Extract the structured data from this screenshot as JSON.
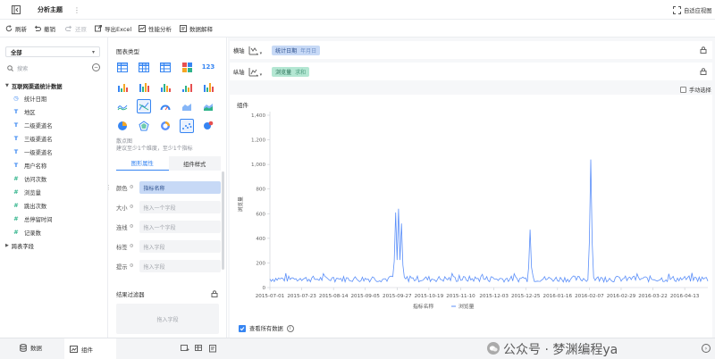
{
  "titlebar": {
    "title": "分析主题",
    "more_icon": "more-vertical-icon",
    "right_label": "自适应视图"
  },
  "toolbar": {
    "items": [
      {
        "label": "刷新",
        "icon": "refresh-icon",
        "enabled": true
      },
      {
        "label": "撤销",
        "icon": "undo-icon",
        "enabled": true
      },
      {
        "label": "还原",
        "icon": "redo-icon",
        "enabled": false
      },
      {
        "label": "导出Excel",
        "icon": "export-icon",
        "enabled": true
      },
      {
        "label": "性能分析",
        "icon": "performance-icon",
        "enabled": true
      },
      {
        "label": "数据解释",
        "icon": "explain-icon",
        "enabled": true
      }
    ]
  },
  "left_panel": {
    "scope_select": "全部",
    "search_placeholder": "搜索",
    "table_name": "互联网渠道统计数据",
    "fields": [
      {
        "type": "date",
        "label": "统计日期"
      },
      {
        "type": "text",
        "label": "地区"
      },
      {
        "type": "text",
        "label": "二级渠道名"
      },
      {
        "type": "text",
        "label": "三级渠道名"
      },
      {
        "type": "text",
        "label": "一级渠道名"
      },
      {
        "type": "text",
        "label": "用户名称"
      },
      {
        "type": "number",
        "label": "访问次数"
      },
      {
        "type": "number",
        "label": "浏览量"
      },
      {
        "type": "number",
        "label": "跳出次数"
      },
      {
        "type": "number",
        "label": "总停留时间"
      },
      {
        "type": "number",
        "label": "记录数"
      }
    ],
    "cross_table": "跨表字段"
  },
  "chart_type_panel": {
    "title": "图表类型",
    "hint_title": "散点图",
    "hint_text": "建议至少1个维度，至少1个指标",
    "tabs": [
      "图形属性",
      "组件样式"
    ],
    "props": [
      {
        "label": "颜色",
        "value": "指标名称",
        "filled": true
      },
      {
        "label": "大小",
        "value": "拖入一个字段",
        "filled": false
      },
      {
        "label": "连线",
        "value": "拖入一个字段",
        "filled": false
      },
      {
        "label": "标签",
        "value": "拖入字段",
        "filled": false
      },
      {
        "label": "提示",
        "value": "拖入字段",
        "filled": false
      }
    ],
    "filter_title": "结果过滤器",
    "filter_placeholder": "拖入字段"
  },
  "axes": {
    "x_label": "横轴",
    "x_field": "统计日期",
    "x_field_sub": "年月日",
    "y_label": "纵轴",
    "y_field": "浏览量",
    "y_field_sub": "求和",
    "manual_select": "手动选择"
  },
  "chart_card": {
    "title": "组件",
    "show_all": "查看所有数据"
  },
  "chart_data": {
    "type": "line",
    "xlabel": "指标名称",
    "ylabel": "浏览量",
    "legend": "浏览量",
    "x_ticks": [
      "2015-07-01",
      "2015-07-23",
      "2015-08-14",
      "2015-09-05",
      "2015-09-27",
      "2015-10-19",
      "2015-11-10",
      "2015-12-03",
      "2015-12-25",
      "2016-01-16",
      "2016-02-07",
      "2016-02-29",
      "2016-03-22",
      "2016-04-13"
    ],
    "y_ticks": [
      "1,400",
      "1,200",
      "1,000",
      "800",
      "600",
      "400",
      "200",
      "0"
    ],
    "ylim": [
      0,
      1400
    ],
    "x_start": "2015-07-01",
    "x_end": "2016-04-29",
    "baseline": 70,
    "peaks": [
      {
        "date": "2015-09-26",
        "value": 610
      },
      {
        "date": "2015-09-28",
        "value": 640
      },
      {
        "date": "2015-09-30",
        "value": 520
      },
      {
        "date": "2015-12-28",
        "value": 470
      },
      {
        "date": "2016-02-08",
        "value": 1040
      }
    ],
    "color": "#5b8ff9"
  },
  "bottombar": {
    "tab1": "数据",
    "tab2": "组件"
  },
  "watermark": "公众号 · 梦渊编程ya"
}
